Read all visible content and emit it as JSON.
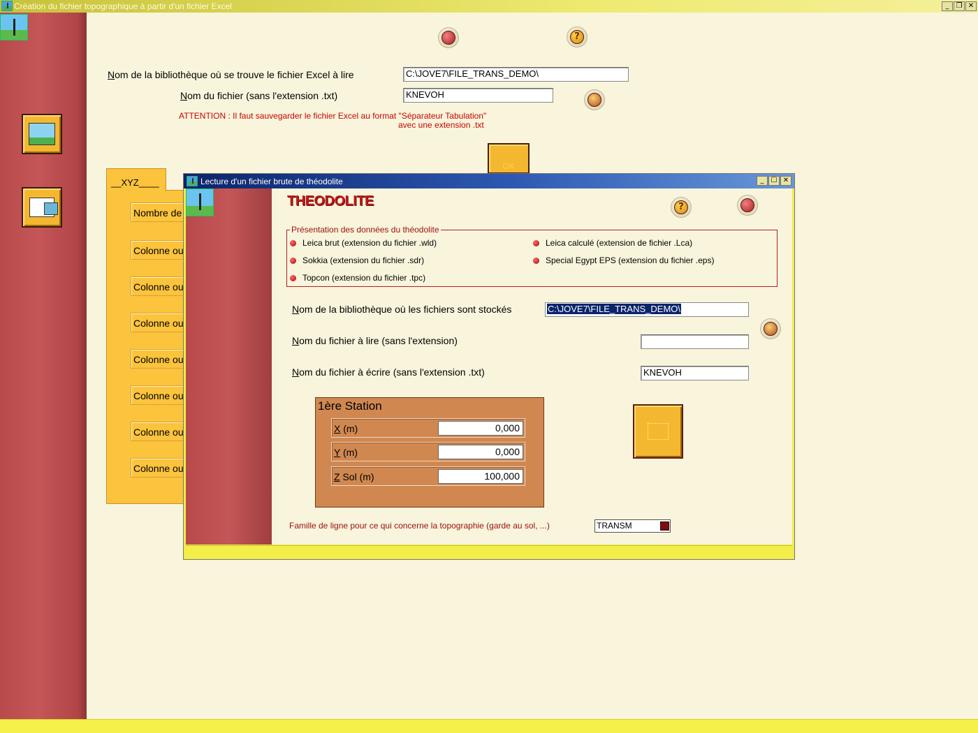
{
  "main_window": {
    "title": "Création du fichier topographique à partir d'un fichier Excel",
    "controls": {
      "minimize": "_",
      "restore": "❐",
      "close": "✕"
    }
  },
  "main_form": {
    "library_label_first": "N",
    "library_label_rest": "om de la bibliothèque où se trouve le fichier Excel à lire",
    "library_value": "C:\\JOVE7\\FILE_TRANS_DEMO\\",
    "filename_label_first": "N",
    "filename_label_rest": "om du fichier (sans l'extension .txt)",
    "filename_value": "KNEVOH",
    "warning_line1": "ATTENTION :  Il faut sauvegarder le fichier Excel au format \"Séparateur Tabulation\"",
    "warning_line2": "avec une extension .txt",
    "ok_label": "OK"
  },
  "tabs": {
    "active_tab": "__XYZ____",
    "fields": [
      "Nombre de",
      "Colonne ou",
      "Colonne ou",
      "Colonne ou",
      "Colonne ou",
      "Colonne ou",
      "Colonne ou",
      "Colonne ou"
    ]
  },
  "dialog": {
    "title": "Lecture d'un fichier brute de théodolite",
    "controls": {
      "minimize": "_",
      "maximize": "☐",
      "close": "✕"
    },
    "heading": "THEODOLITE",
    "presentation_legend": "Présentation des données du théodolite",
    "options_left": [
      "Leica brut (extension du fichier .wld)",
      "Sokkia (extension du fichier .sdr)",
      "Topcon (extension du fichier .tpc)"
    ],
    "options_right": [
      "Leica calculé (extension de fichier .Lca)",
      "Special Egypt EPS (extension du fichier .eps)"
    ],
    "library_label_first": "N",
    "library_label_rest": "om de la bibliothèque où les fichiers sont stockés",
    "library_value": "C:\\JOVE7\\FILE_TRANS_DEMO\\",
    "read_label_first": "N",
    "read_label_rest": "om du fichier à lire (sans l'extension)",
    "read_value": "",
    "write_label_first": "N",
    "write_label_rest": "om du fichier à écrire (sans l'extension .txt)",
    "write_value": "KNEVOH",
    "station": {
      "title": "1ère Station",
      "x_key": "X",
      "x_rest": " (m)",
      "x_value": "0,000",
      "y_key": "Y",
      "y_rest": " (m)",
      "y_value": "0,000",
      "z_key": "Z",
      "z_rest": " Sol (m)",
      "z_value": "100,000"
    },
    "family_label": "Famille de ligne pour ce qui concerne la topographie (garde au sol, ...)",
    "family_value": "TRANSM"
  },
  "icons": {
    "help": "help-icon",
    "exit": "exit-icon",
    "browse": "folder-key-icon"
  }
}
